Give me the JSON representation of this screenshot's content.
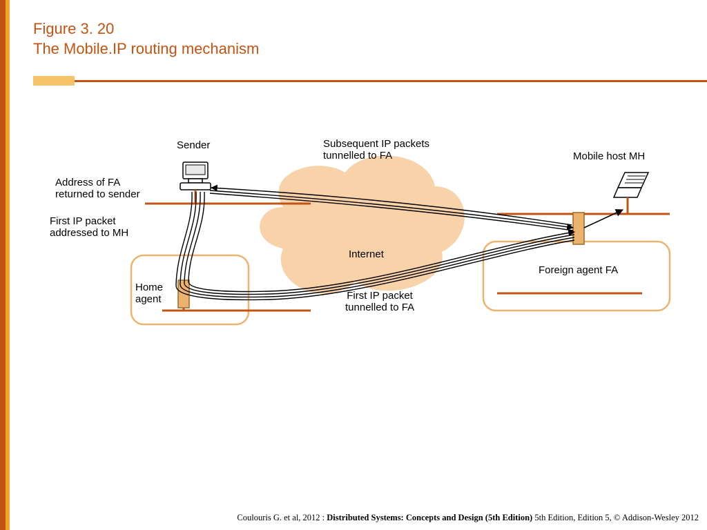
{
  "heading": {
    "line1": "Figure 3. 20",
    "line2": "The Mobile.IP routing mechanism"
  },
  "labels": {
    "sender": "Sender",
    "sub_tunnel_l1": "Subsequent IP packets",
    "sub_tunnel_l2": "tunnelled to FA",
    "mobile_host": "Mobile host MH",
    "addr_fa_l1": "Address of FA",
    "addr_fa_l2": "returned to sender",
    "first_to_mh_l1": "First IP packet",
    "first_to_mh_l2": "addressed to MH",
    "internet": "Internet",
    "foreign_agent": "Foreign agent FA",
    "home_agent_l1": "Home",
    "home_agent_l2": "agent",
    "first_tun_l1": "First IP packet",
    "first_tun_l2": "tunnelled to FA"
  },
  "footer": {
    "pre": "Coulouris G. et al, 2012 : ",
    "bold": "Distributed  Systems: Concepts and Design (5th Edition)",
    "post": " 5th Edition, Edition 5, © Addison-Wesley 2012"
  },
  "colors": {
    "orange": "#c15413",
    "gold": "#f0a628",
    "peach_fill": "#f8d2a8",
    "peach_stroke": "#ecb36e",
    "network_stroke": "#c15413"
  }
}
